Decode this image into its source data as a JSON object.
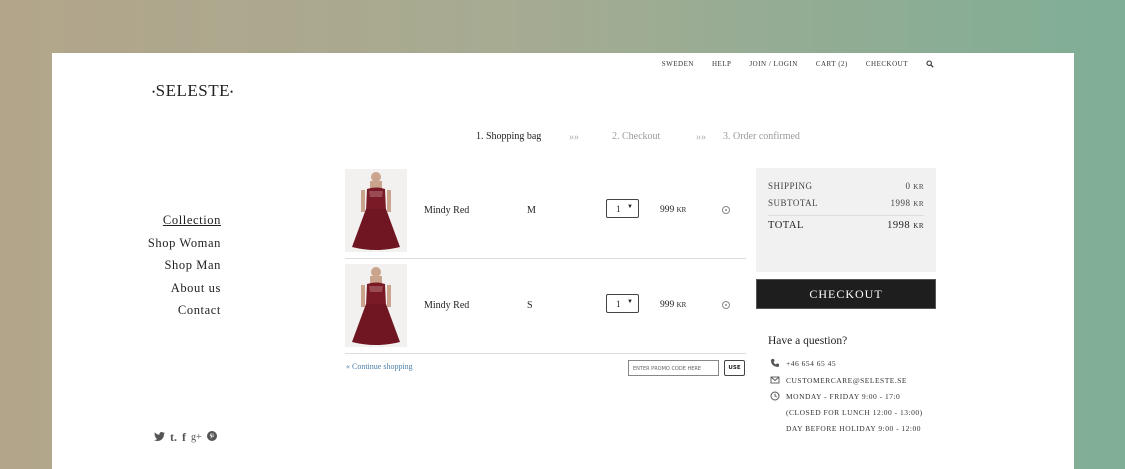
{
  "topnav": {
    "country": "SWEDEN",
    "help": "HELP",
    "join": "JOIN / LOGIN",
    "cart": "CART (2)",
    "checkout": "CHECKOUT"
  },
  "logo": {
    "text": "SELESTE",
    "dot": "•"
  },
  "steps": {
    "step1": "1. Shopping bag",
    "step2": "2. Checkout",
    "step3": "3. Order confirmed",
    "arrow": "»»"
  },
  "sidemenu": {
    "collection": "Collection",
    "shop_woman": "Shop Woman",
    "shop_man": "Shop Man",
    "about": "About us",
    "contact": "Contact"
  },
  "social": {
    "twitter": "twitter-icon",
    "tumblr": "t.",
    "facebook": "f",
    "googleplus": "g+",
    "pinterest": "pinterest-icon"
  },
  "cart": {
    "items": [
      {
        "name": "Mindy Red",
        "size": "M",
        "quantity": "1",
        "price": "999",
        "currency": "KR",
        "image": "red-dress"
      },
      {
        "name": "Mindy Red",
        "size": "S",
        "quantity": "1",
        "price": "999",
        "currency": "KR",
        "image": "red-dress"
      }
    ],
    "continue": "« Continue shopping",
    "promo_placeholder": "ENTER PROMO CODE HERE",
    "use": "USE"
  },
  "summary": {
    "shipping_label": "SHIPPING",
    "shipping_value": "0",
    "currency": "KR",
    "subtotal_label": "SUBTOTAL",
    "subtotal_value": "1998",
    "total_label": "TOTAL",
    "total_value": "1998",
    "checkout": "CHECKOUT"
  },
  "help": {
    "title": "Have a question?",
    "phone": "+46 654 65 45",
    "email": "CUSTOMERCARE@SELESTE.SE",
    "hours": "MONDAY - FRIDAY 9:00 - 17:0",
    "lunch": "(CLOSED FOR LUNCH 12:00 - 13:00)",
    "holiday": "DAY BEFORE HOLIDAY 9:00 - 12:00"
  },
  "colors": {
    "dress": "#7a1a26",
    "link": "#4a7ea8",
    "button": "#1e1e1e"
  }
}
